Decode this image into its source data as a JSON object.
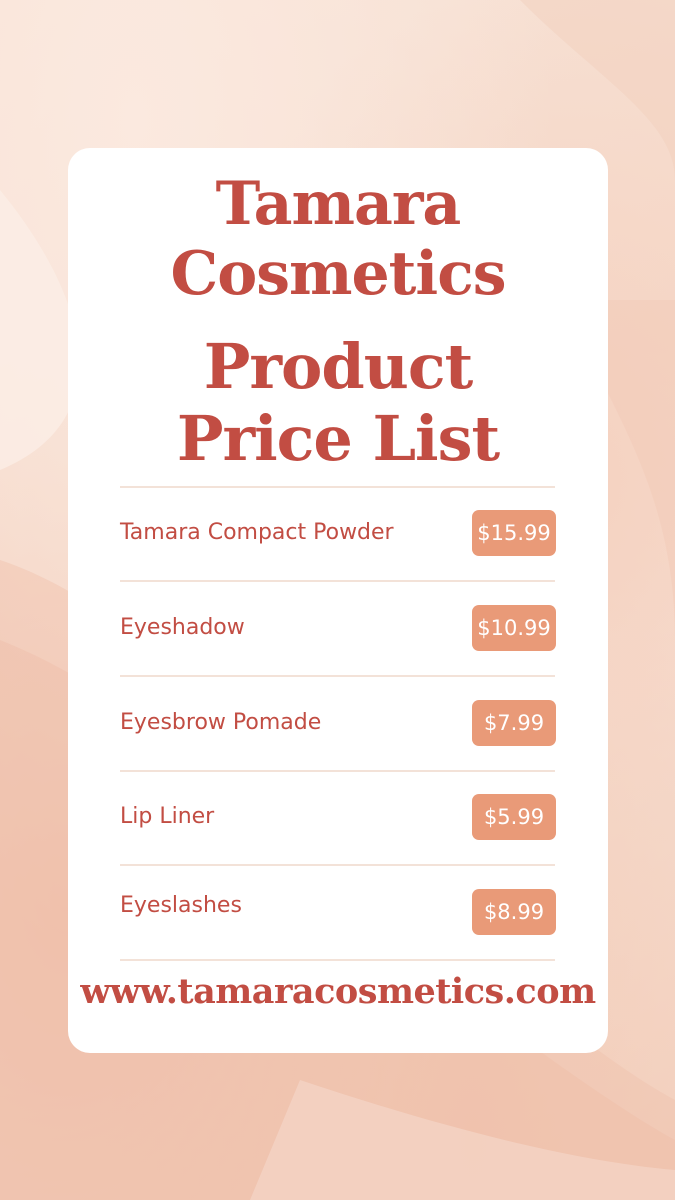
{
  "brand_line_1": "Tamara",
  "brand_line_2": "Cosmetics",
  "heading_line_1": "Product",
  "heading_line_2": "Price List",
  "products": [
    {
      "name": "Tamara Compact Powder",
      "price": "$15.99"
    },
    {
      "name": "Eyeshadow",
      "price": "$10.99"
    },
    {
      "name": "Eyesbrow Pomade",
      "price": "$7.99"
    },
    {
      "name": "Lip Liner",
      "price": "$5.99"
    },
    {
      "name": "Eyeslashes",
      "price": "$8.99"
    }
  ],
  "website": "www.tamaracosmetics.com",
  "colors": {
    "accent": "#c24d43",
    "price_badge": "#e99a78",
    "card": "#ffffff",
    "background": "#f7e0d3"
  }
}
